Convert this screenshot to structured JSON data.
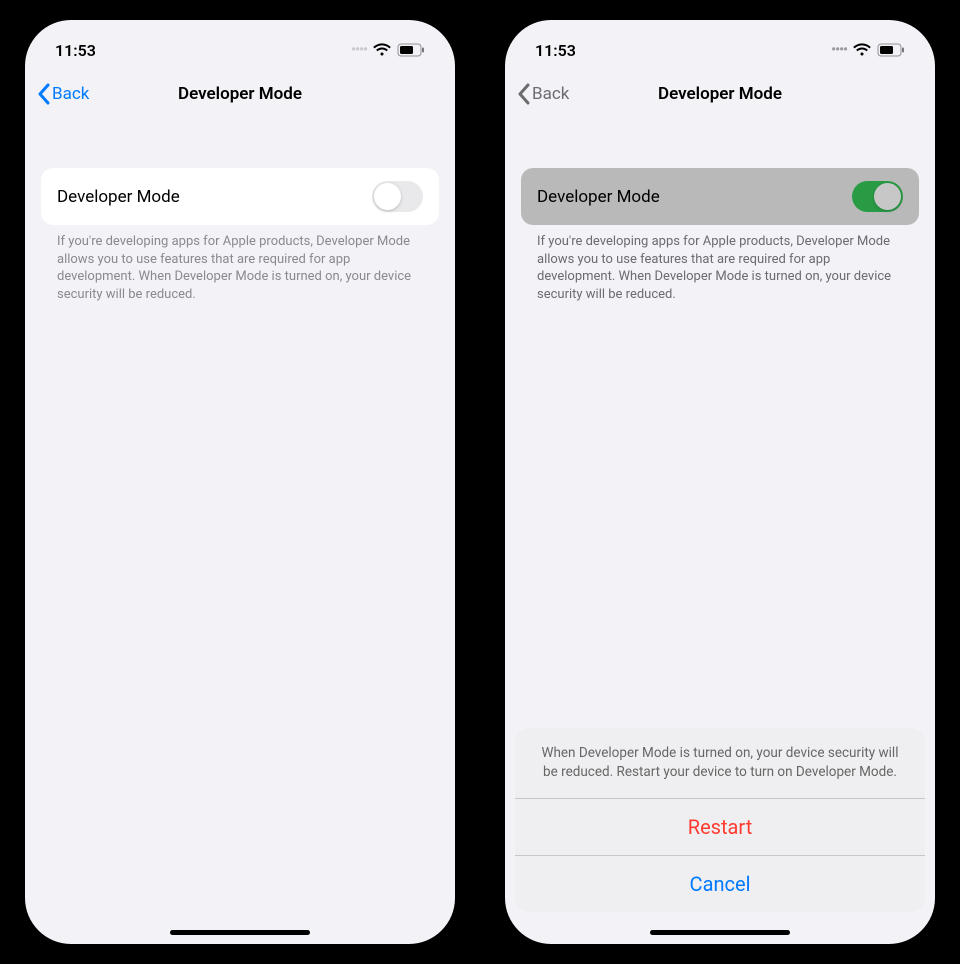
{
  "left": {
    "status": {
      "time": "11:53"
    },
    "nav": {
      "back": "Back",
      "title": "Developer Mode"
    },
    "row": {
      "label": "Developer Mode",
      "switchOn": false
    },
    "footer": "If you're developing apps for Apple products, Developer Mode allows you to use features that are required for app development. When Developer Mode is turned on, your device security will be reduced."
  },
  "right": {
    "status": {
      "time": "11:53"
    },
    "nav": {
      "back": "Back",
      "title": "Developer Mode"
    },
    "row": {
      "label": "Developer Mode",
      "switchOn": true
    },
    "footer": "If you're developing apps for Apple products, Developer Mode allows you to use features that are required for app development. When Developer Mode is turned on, your device security will be reduced.",
    "sheet": {
      "message": "When Developer Mode is turned on, your device security will be reduced. Restart your device to turn on Developer Mode.",
      "restart": "Restart",
      "cancel": "Cancel"
    }
  }
}
